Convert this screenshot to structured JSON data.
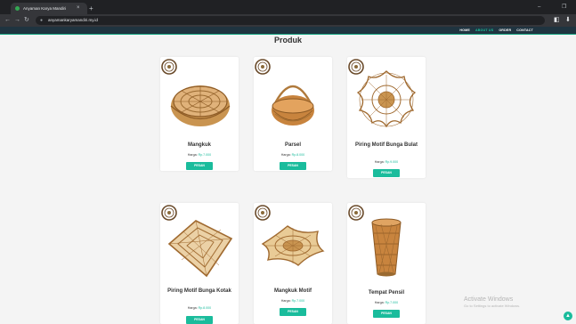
{
  "browser": {
    "tab_title": "Anyaman Karya Mandiri",
    "tab_close": "×",
    "new_tab": "+",
    "url": "anyamankaryamandiri.my.id",
    "window_controls": [
      "–",
      "❐"
    ]
  },
  "site_nav": {
    "items": [
      {
        "label": "HOME",
        "active": false
      },
      {
        "label": "ABOUT US",
        "active": true
      },
      {
        "label": "ORDER",
        "active": false
      },
      {
        "label": "CONTACT",
        "active": false
      }
    ]
  },
  "page": {
    "title": "Produk"
  },
  "products": [
    {
      "name": "Mangkuk",
      "price_label": "Harga:",
      "price": "Rp.7.000",
      "button": "PESAN",
      "image": "round-bowl-basket"
    },
    {
      "name": "Parsel",
      "price_label": "Harga:",
      "price": "Rp.8.000",
      "button": "PESAN",
      "image": "handle-basket"
    },
    {
      "name": "Piring Motif Bunga Bulat",
      "price_label": "Harga:",
      "price": "Rp.9.000",
      "button": "PESAN",
      "image": "flower-round-plate"
    },
    {
      "name": "Piring Motif Bunga Kotak",
      "price_label": "Harga:",
      "price": "Rp.8.000",
      "button": "PESAN",
      "image": "flower-square-plate"
    },
    {
      "name": "Mangkuk Motif",
      "price_label": "Harga:",
      "price": "Rp.7.000",
      "button": "PESAN",
      "image": "motif-bowl"
    },
    {
      "name": "Tempat Pensil",
      "price_label": "Harga:",
      "price": "Rp.7.000",
      "button": "PESAN",
      "image": "pencil-holder"
    }
  ],
  "activate_windows": {
    "line1": "Activate Windows",
    "line2": "Go to Settings to activate Windows."
  },
  "colors": {
    "accent": "#1abc9c",
    "nav_bg": "#1f3440",
    "basket": "#b07a3c"
  }
}
